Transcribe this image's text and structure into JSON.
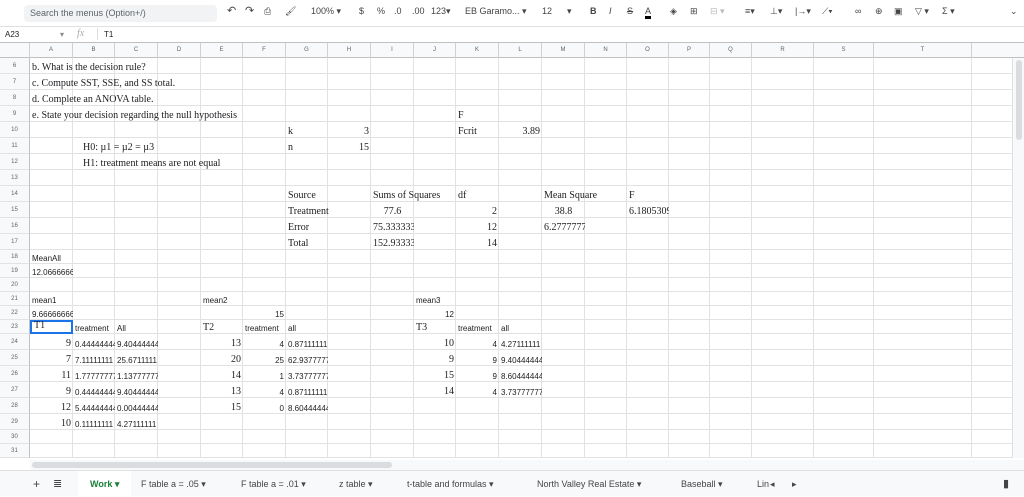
{
  "toolbar": {
    "search_placeholder": "Search the menus (Option+/)",
    "zoom": "100%",
    "currency": "$",
    "percent": "%",
    "dec_less": ".0",
    "dec_more": ".00",
    "format": "123",
    "font": "EB Garamo...",
    "font_size": "12",
    "bold": "B",
    "italic": "I",
    "strike": "S",
    "text_color": "A",
    "sum": "Σ"
  },
  "formula_bar": {
    "cell_ref": "A23",
    "fx": "fx",
    "value": "T1"
  },
  "columns": [
    "A",
    "B",
    "C",
    "D",
    "E",
    "F",
    "G",
    "H",
    "I",
    "J",
    "K",
    "L",
    "M",
    "N",
    "O",
    "P",
    "Q",
    "R",
    "S",
    "T"
  ],
  "rows": [
    6,
    7,
    8,
    9,
    10,
    11,
    12,
    13,
    14,
    15,
    16,
    17,
    18,
    19,
    20,
    21,
    22,
    23,
    24,
    25,
    26,
    27,
    28,
    29,
    30,
    31
  ],
  "cells": [
    {
      "ref": "A6",
      "v": "b. What is the decision rule?",
      "f": "serif"
    },
    {
      "ref": "A7",
      "v": "c. Compute SST, SSE, and SS total.",
      "f": "serif"
    },
    {
      "ref": "A8",
      "v": "d. Complete an ANOVA table.",
      "f": "serif"
    },
    {
      "ref": "A9",
      "v": "e. State your decision regarding the null hypothesis",
      "f": "serif"
    },
    {
      "ref": "K9",
      "v": "F",
      "f": "serif"
    },
    {
      "ref": "G10",
      "v": "k",
      "f": "serif"
    },
    {
      "ref": "H10",
      "v": "3",
      "f": "serif",
      "a": "r"
    },
    {
      "ref": "K10",
      "v": "Fcrit",
      "f": "serif"
    },
    {
      "ref": "L10",
      "v": "3.89",
      "f": "serif",
      "a": "r"
    },
    {
      "ref": "B11",
      "v": "H0: µ1 = µ2 = µ3",
      "f": "serif",
      "pad": true
    },
    {
      "ref": "G11",
      "v": "n",
      "f": "serif"
    },
    {
      "ref": "H11",
      "v": "15",
      "f": "serif",
      "a": "r"
    },
    {
      "ref": "B12",
      "v": "H1: treatment means are not equal",
      "f": "serif",
      "pad": true
    },
    {
      "ref": "G14",
      "v": "Source",
      "f": "serif"
    },
    {
      "ref": "I14",
      "v": "Sums of Squares",
      "f": "serif"
    },
    {
      "ref": "K14",
      "v": "df",
      "f": "serif"
    },
    {
      "ref": "M14",
      "v": "Mean Square",
      "f": "serif"
    },
    {
      "ref": "O14",
      "v": "F",
      "f": "serif"
    },
    {
      "ref": "G15",
      "v": "Treatment",
      "f": "serif"
    },
    {
      "ref": "I15",
      "v": "77.6",
      "f": "serif",
      "a": "c"
    },
    {
      "ref": "K15",
      "v": "2",
      "f": "serif",
      "a": "r"
    },
    {
      "ref": "M15",
      "v": "38.8",
      "f": "serif",
      "a": "c"
    },
    {
      "ref": "O15",
      "v": "6.18053097",
      "f": "serif",
      "clip": true
    },
    {
      "ref": "G16",
      "v": "Error",
      "f": "serif"
    },
    {
      "ref": "I16",
      "v": "75.3333333",
      "f": "serif",
      "clip": true
    },
    {
      "ref": "K16",
      "v": "12",
      "f": "serif",
      "a": "r"
    },
    {
      "ref": "M16",
      "v": "6.27777778",
      "f": "serif",
      "clip": true
    },
    {
      "ref": "G17",
      "v": "Total",
      "f": "serif"
    },
    {
      "ref": "I17",
      "v": "152.933333",
      "f": "serif",
      "clip": true
    },
    {
      "ref": "K17",
      "v": "14",
      "f": "serif",
      "a": "r"
    },
    {
      "ref": "A18",
      "v": "MeanAll",
      "f": "sans"
    },
    {
      "ref": "A19",
      "v": "12.0666666",
      "f": "sans",
      "clip": true
    },
    {
      "ref": "A21",
      "v": "mean1",
      "f": "sans"
    },
    {
      "ref": "E21",
      "v": "mean2",
      "f": "sans"
    },
    {
      "ref": "J21",
      "v": "mean3",
      "f": "sans"
    },
    {
      "ref": "A22",
      "v": "9.66666666",
      "f": "sans",
      "clip": true
    },
    {
      "ref": "F22",
      "v": "15",
      "f": "sans",
      "a": "r"
    },
    {
      "ref": "J22",
      "v": "12",
      "f": "sans",
      "a": "r"
    },
    {
      "ref": "A23",
      "v": "T1",
      "f": "serif",
      "sel": true
    },
    {
      "ref": "B23",
      "v": "treatment",
      "f": "sans"
    },
    {
      "ref": "C23",
      "v": "All",
      "f": "sans"
    },
    {
      "ref": "E23",
      "v": "T2",
      "f": "serif"
    },
    {
      "ref": "F23",
      "v": "treatment",
      "f": "sans"
    },
    {
      "ref": "G23",
      "v": "all",
      "f": "sans"
    },
    {
      "ref": "J23",
      "v": "T3",
      "f": "serif"
    },
    {
      "ref": "K23",
      "v": "treatment",
      "f": "sans"
    },
    {
      "ref": "L23",
      "v": "all",
      "f": "sans"
    },
    {
      "ref": "A24",
      "v": "9",
      "f": "serif",
      "a": "r"
    },
    {
      "ref": "B24",
      "v": "0.44444444",
      "f": "sans",
      "clip": true
    },
    {
      "ref": "C24",
      "v": "9.40444444",
      "f": "sans",
      "clip": true
    },
    {
      "ref": "E24",
      "v": "13",
      "f": "serif",
      "a": "r"
    },
    {
      "ref": "F24",
      "v": "4",
      "f": "sans",
      "a": "r"
    },
    {
      "ref": "G24",
      "v": "0.87111111",
      "f": "sans",
      "clip": true
    },
    {
      "ref": "J24",
      "v": "10",
      "f": "serif",
      "a": "r"
    },
    {
      "ref": "K24",
      "v": "4",
      "f": "sans",
      "a": "r"
    },
    {
      "ref": "L24",
      "v": "4.27111111",
      "f": "sans",
      "clip": true
    },
    {
      "ref": "A25",
      "v": "7",
      "f": "serif",
      "a": "r"
    },
    {
      "ref": "B25",
      "v": "7.11111111",
      "f": "sans",
      "clip": true
    },
    {
      "ref": "C25",
      "v": "25.6711111",
      "f": "sans",
      "clip": true
    },
    {
      "ref": "E25",
      "v": "20",
      "f": "serif",
      "a": "r"
    },
    {
      "ref": "F25",
      "v": "25",
      "f": "sans",
      "a": "r"
    },
    {
      "ref": "G25",
      "v": "62.9377777",
      "f": "sans",
      "clip": true
    },
    {
      "ref": "J25",
      "v": "9",
      "f": "serif",
      "a": "r"
    },
    {
      "ref": "K25",
      "v": "9",
      "f": "sans",
      "a": "r"
    },
    {
      "ref": "L25",
      "v": "9.40444444",
      "f": "sans",
      "clip": true
    },
    {
      "ref": "A26",
      "v": "11",
      "f": "serif",
      "a": "r"
    },
    {
      "ref": "B26",
      "v": "1.77777777",
      "f": "sans",
      "clip": true
    },
    {
      "ref": "C26",
      "v": "1.13777777",
      "f": "sans",
      "clip": true
    },
    {
      "ref": "E26",
      "v": "14",
      "f": "serif",
      "a": "r"
    },
    {
      "ref": "F26",
      "v": "1",
      "f": "sans",
      "a": "r"
    },
    {
      "ref": "G26",
      "v": "3.73777777",
      "f": "sans",
      "clip": true
    },
    {
      "ref": "J26",
      "v": "15",
      "f": "serif",
      "a": "r"
    },
    {
      "ref": "K26",
      "v": "9",
      "f": "sans",
      "a": "r"
    },
    {
      "ref": "L26",
      "v": "8.60444444",
      "f": "sans",
      "clip": true
    },
    {
      "ref": "A27",
      "v": "9",
      "f": "serif",
      "a": "r"
    },
    {
      "ref": "B27",
      "v": "0.44444444",
      "f": "sans",
      "clip": true
    },
    {
      "ref": "C27",
      "v": "9.40444444",
      "f": "sans",
      "clip": true
    },
    {
      "ref": "E27",
      "v": "13",
      "f": "serif",
      "a": "r"
    },
    {
      "ref": "F27",
      "v": "4",
      "f": "sans",
      "a": "r"
    },
    {
      "ref": "G27",
      "v": "0.87111111",
      "f": "sans",
      "clip": true
    },
    {
      "ref": "J27",
      "v": "14",
      "f": "serif",
      "a": "r"
    },
    {
      "ref": "K27",
      "v": "4",
      "f": "sans",
      "a": "r"
    },
    {
      "ref": "L27",
      "v": "3.73777777",
      "f": "sans",
      "clip": true
    },
    {
      "ref": "A28",
      "v": "12",
      "f": "serif",
      "a": "r"
    },
    {
      "ref": "B28",
      "v": "5.44444444",
      "f": "sans",
      "clip": true
    },
    {
      "ref": "C28",
      "v": "0.00444444",
      "f": "sans",
      "clip": true
    },
    {
      "ref": "E28",
      "v": "15",
      "f": "serif",
      "a": "r"
    },
    {
      "ref": "F28",
      "v": "0",
      "f": "sans",
      "a": "r"
    },
    {
      "ref": "G28",
      "v": "8.60444444",
      "f": "sans",
      "clip": true
    },
    {
      "ref": "A29",
      "v": "10",
      "f": "serif",
      "a": "r"
    },
    {
      "ref": "B29",
      "v": "0.11111111",
      "f": "sans",
      "clip": true
    },
    {
      "ref": "C29",
      "v": "4.27111111",
      "f": "sans",
      "clip": true
    }
  ],
  "sheet_tabs": [
    {
      "label": "Work ▾",
      "active": true
    },
    {
      "label": "F table a = .05 ▾"
    },
    {
      "label": "F table a = .01 ▾"
    },
    {
      "label": "z table ▾"
    },
    {
      "label": "t-table and formulas ▾"
    },
    {
      "label": "North Valley Real Estate ▾"
    },
    {
      "label": "Baseball ▾"
    },
    {
      "label": "Lin"
    }
  ],
  "add_sheet": "+",
  "all_sheets": "≣",
  "tab_prev": "◂",
  "tab_next": "▸",
  "colors": {
    "accent": "#1a73e8",
    "active_tab": "#188038"
  }
}
